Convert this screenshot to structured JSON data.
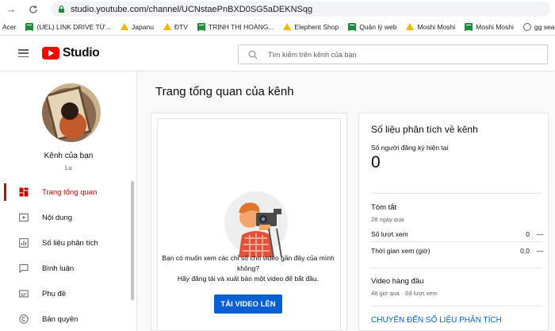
{
  "browser": {
    "url": "studio.youtube.com/channel/UCNstaePnBXD0SG5aDEKNSqg",
    "bookmarks": [
      {
        "label": "Acer",
        "icon": "none"
      },
      {
        "label": "(UEL) LINK DRIVE TỪ...",
        "icon": "sheet"
      },
      {
        "label": "Japanu",
        "icon": "drive"
      },
      {
        "label": "ĐTV",
        "icon": "drive"
      },
      {
        "label": "TRỊNH THỊ HOÀNG...",
        "icon": "sheet"
      },
      {
        "label": "Elephent Shop",
        "icon": "drive"
      },
      {
        "label": "Quản lý web",
        "icon": "sheet"
      },
      {
        "label": "Moshi Moshi",
        "icon": "drive"
      },
      {
        "label": "Moshi Moshi",
        "icon": "sheet"
      },
      {
        "label": "gg search console",
        "icon": "globe"
      }
    ]
  },
  "header": {
    "logo_text": "Studio",
    "search_placeholder": "Tìm kiếm trên kênh của bạn"
  },
  "sidebar": {
    "channel_name": "Kênh của bạn",
    "channel_handle": "Lu",
    "items": [
      {
        "label": "Trang tổng quan",
        "icon": "dashboard-icon",
        "active": true
      },
      {
        "label": "Nội dung",
        "icon": "content-icon",
        "active": false
      },
      {
        "label": "Số liệu phân tích",
        "icon": "analytics-icon",
        "active": false
      },
      {
        "label": "Bình luận",
        "icon": "comments-icon",
        "active": false
      },
      {
        "label": "Phụ đề",
        "icon": "subtitles-icon",
        "active": false
      },
      {
        "label": "Bản quyền",
        "icon": "copyright-icon",
        "active": false
      }
    ]
  },
  "main": {
    "page_title": "Trang tổng quan của kênh",
    "upload_card": {
      "message_line1": "Bạn có muốn xem các chỉ số cho video gần đây của mình không?",
      "message_line2": "Hãy đăng tải và xuất bản một video để bắt đầu.",
      "button_label": "TẢI VIDEO LÊN"
    },
    "analytics_card": {
      "title": "Số liệu phân tích về kênh",
      "subscribers_label": "Số người đăng ký hiện tại",
      "subscribers_count": "0",
      "summary_title": "Tóm tắt",
      "summary_period": "28 ngày qua",
      "views_label": "Số lượt xem",
      "views_value": "0",
      "views_delta": "—",
      "watch_label": "Thời gian xem (giờ)",
      "watch_value": "0,0",
      "watch_delta": "—",
      "top_videos_title": "Video hàng đầu",
      "top_videos_period": "48 giờ qua · Số lượt xem",
      "link_label": "CHUYỂN ĐẾN SỐ LIỆU PHÂN TÍCH"
    }
  },
  "colors": {
    "accent_red": "#cc0000",
    "link_blue": "#065fd4",
    "youtube_red": "#ff0000"
  }
}
